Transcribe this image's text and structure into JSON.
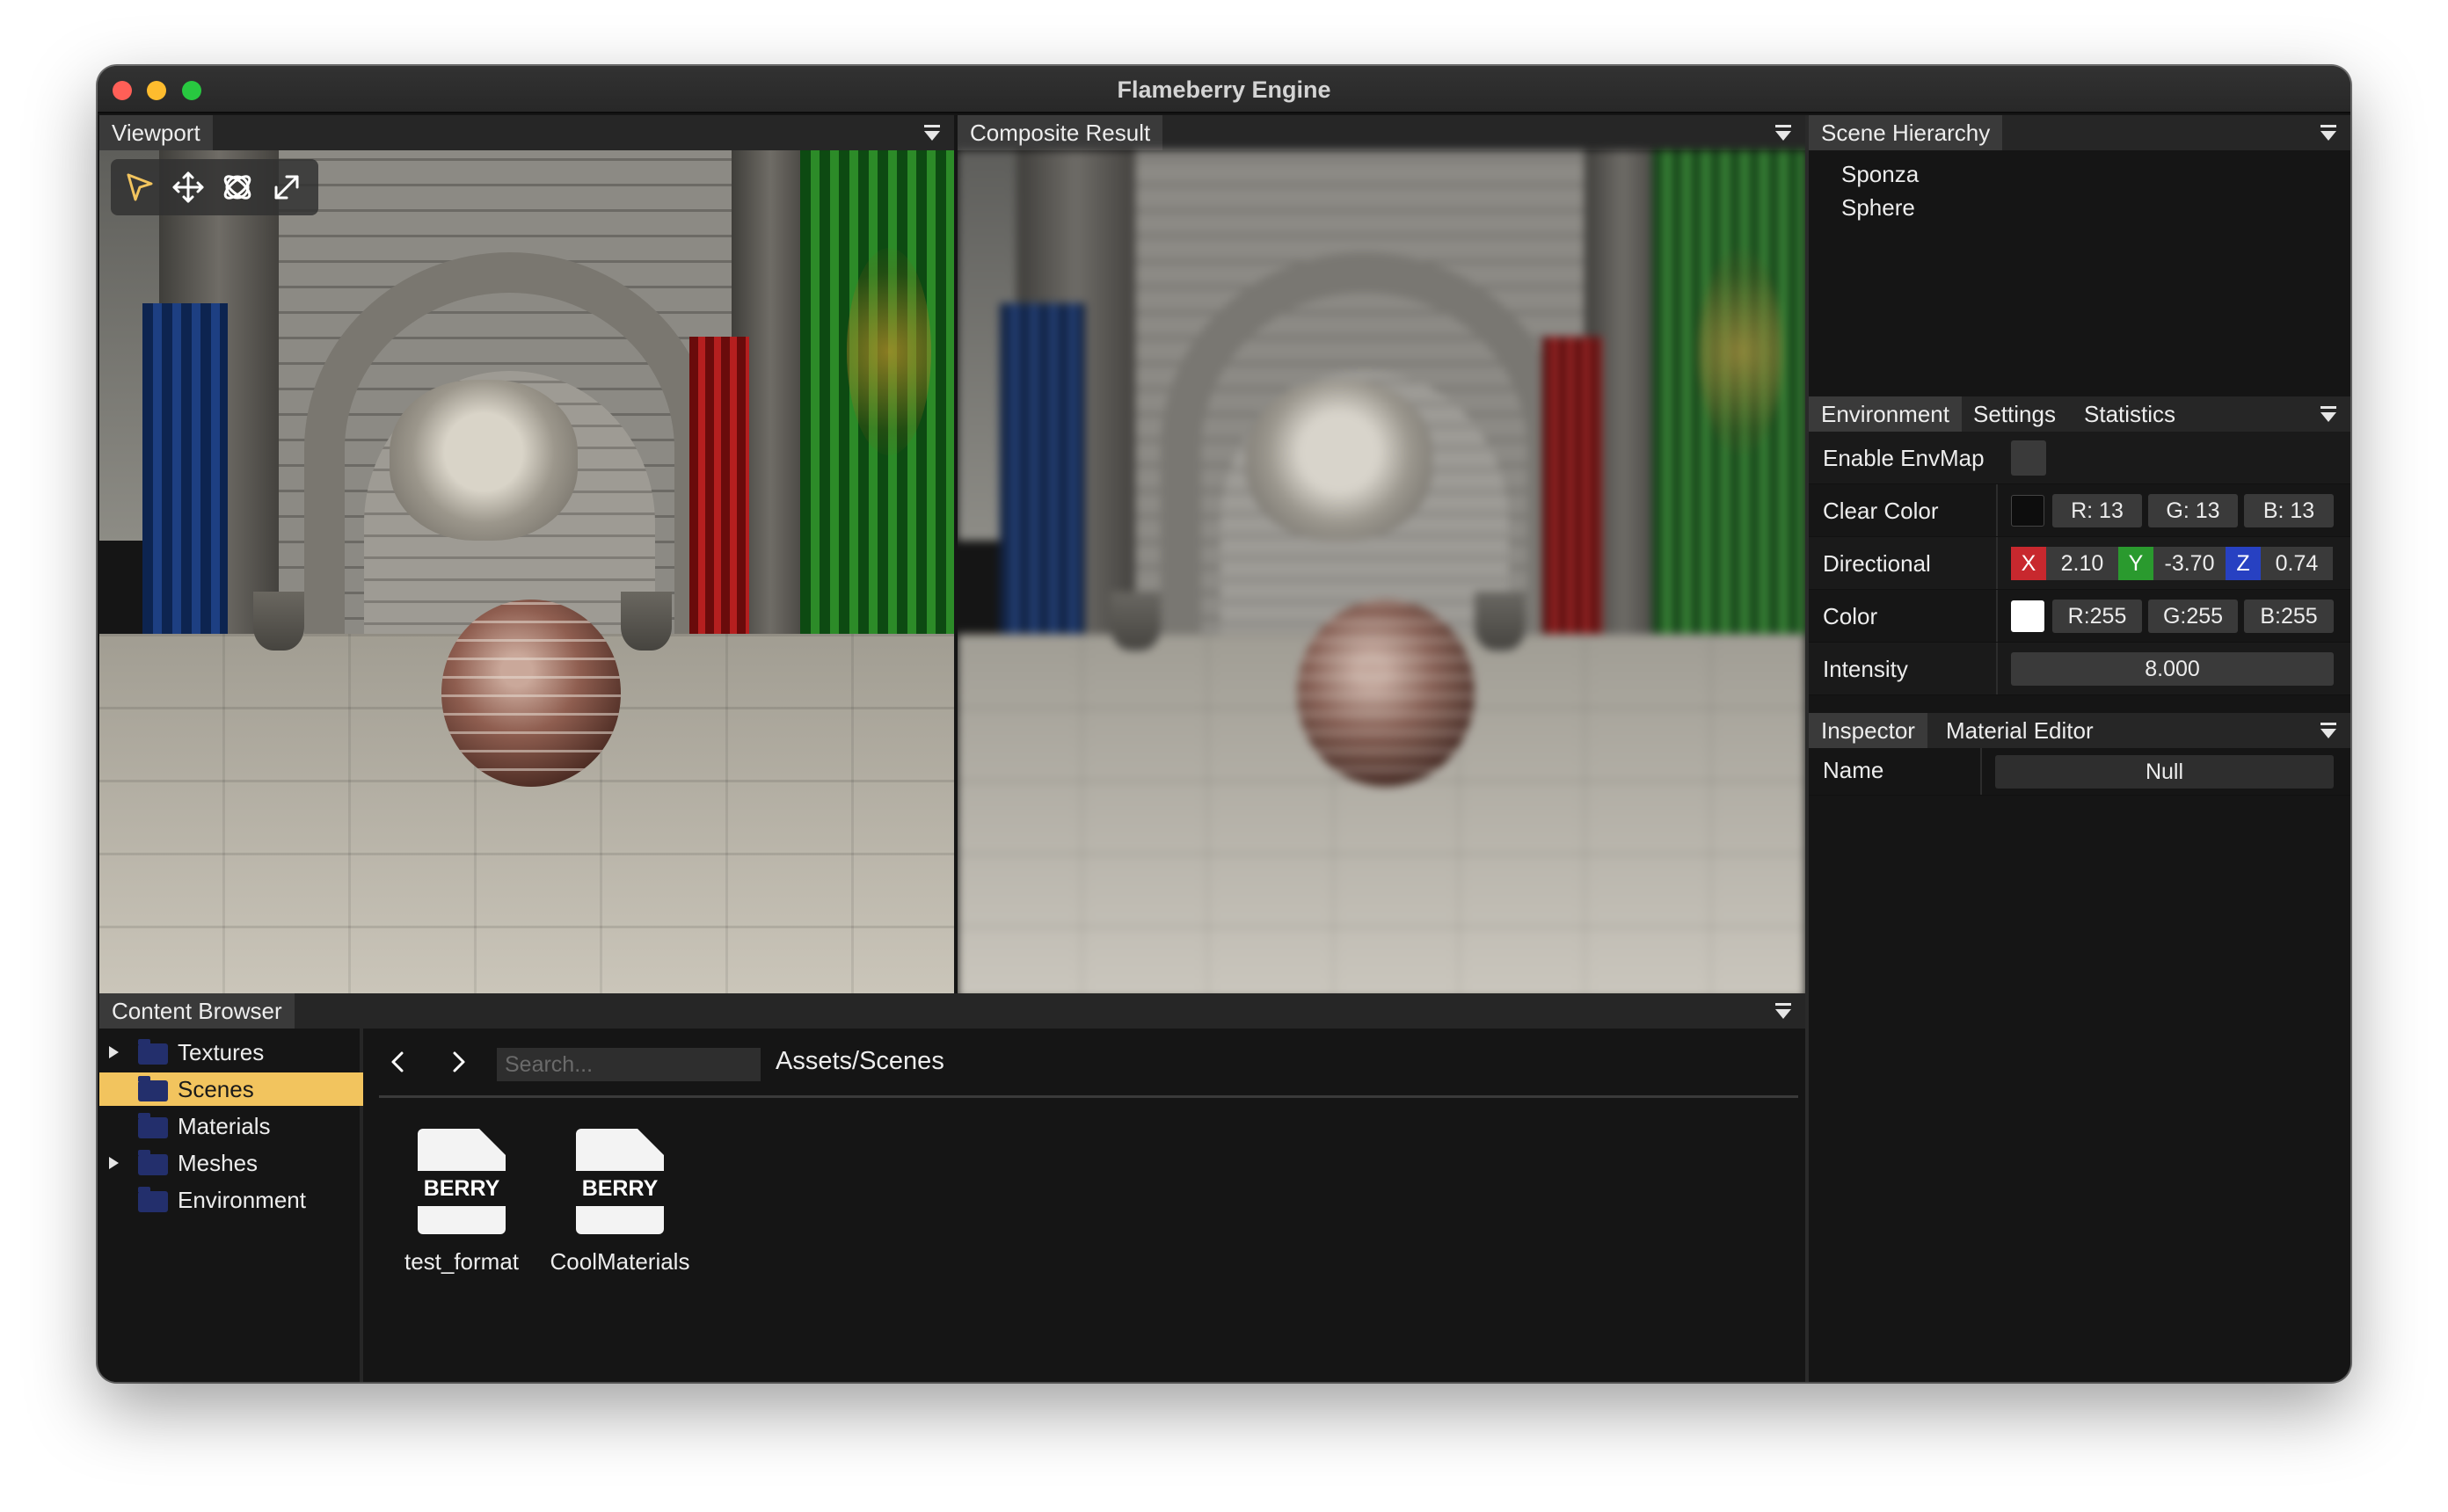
{
  "window": {
    "title": "Flameberry Engine"
  },
  "viewport": {
    "title": "Viewport",
    "tools": [
      {
        "name": "select-tool",
        "icon": "cursor-arrow-icon"
      },
      {
        "name": "translate-tool",
        "icon": "move-arrows-icon"
      },
      {
        "name": "rotate-tool",
        "icon": "rotate-orbit-icon"
      },
      {
        "name": "scale-tool",
        "icon": "scale-diagonal-icon"
      }
    ]
  },
  "composite": {
    "title": "Composite Result"
  },
  "hierarchy": {
    "title": "Scene Hierarchy",
    "items": [
      "Sponza",
      "Sphere"
    ]
  },
  "environment": {
    "tabs": [
      "Environment",
      "Settings",
      "Statistics"
    ],
    "enable_envmap": {
      "label": "Enable EnvMap",
      "checked": false
    },
    "clear_color": {
      "label": "Clear Color",
      "swatch": "#0d0d0d",
      "r": "R: 13",
      "g": "G: 13",
      "b": "B: 13"
    },
    "directional": {
      "label": "Directional",
      "x_label": "X",
      "x": "2.10",
      "y_label": "Y",
      "y": "-3.70",
      "z_label": "Z",
      "z": "0.74"
    },
    "color": {
      "label": "Color",
      "swatch": "#ffffff",
      "r": "R:255",
      "g": "G:255",
      "b": "B:255"
    },
    "intensity": {
      "label": "Intensity",
      "value": "8.000"
    }
  },
  "inspector": {
    "tabs": [
      "Inspector",
      "Material Editor"
    ],
    "name_label": "Name",
    "name_value": "Null"
  },
  "content_browser": {
    "title": "Content Browser",
    "tree": [
      {
        "label": "Textures",
        "expandable": true,
        "selected": false
      },
      {
        "label": "Scenes",
        "expandable": false,
        "selected": true
      },
      {
        "label": "Materials",
        "expandable": false,
        "selected": false
      },
      {
        "label": "Meshes",
        "expandable": true,
        "selected": false
      },
      {
        "label": "Environment",
        "expandable": false,
        "selected": false
      }
    ],
    "search_placeholder": "Search...",
    "path": "Assets/Scenes",
    "assets": [
      {
        "badge": "BERRY",
        "label": "test_format"
      },
      {
        "badge": "BERRY",
        "label": "CoolMaterials"
      }
    ]
  },
  "colors": {
    "accent_selected": "#f2c45e",
    "folder": "#232f6c",
    "axis_x": "#c8282e",
    "axis_y": "#2a9a2e",
    "axis_z": "#2741c2"
  }
}
